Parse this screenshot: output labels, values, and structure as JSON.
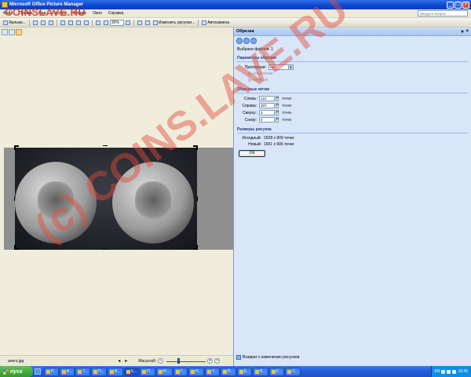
{
  "window": {
    "title": "Microsoft Office Picture Manager"
  },
  "watermark": {
    "top": "COINSLAVE.RU",
    "diagonal": "(c) COINS.LAVE.RU"
  },
  "menubar": {
    "items": [
      "Файл",
      "Правка",
      "Вид",
      "Рисунок",
      "Сервис",
      "Окно",
      "Справка"
    ],
    "help_placeholder": "Введите вопрос"
  },
  "toolbar": {
    "shortcuts_label": "Ярлыки...",
    "zoom_value": "30%",
    "edit_pictures_label": "Изменить рисунки...",
    "autocorrect_label": "Автозамена"
  },
  "canvas": {
    "filename": "avers.jpg",
    "zoom_label": "Масштаб:",
    "zoom_position": 0.3
  },
  "taskpane": {
    "title": "Обрезка",
    "selected_files": "Выбрано файлов: 1",
    "crop_params_title": "Параметры обрезки",
    "proportions_label": "Пропорции:",
    "proportions_value": "Нет",
    "orientation_landscape": "альбомная",
    "orientation_portrait": "книжная",
    "crop_marks_title": "Обрезные метки",
    "left_label": "Слева:",
    "left_value": "121",
    "right_label": "Справа:",
    "right_value": "307",
    "top_label": "Сверху:",
    "top_value": "3",
    "bottom_label": "Снизу:",
    "bottom_value": "0",
    "units": "точек",
    "sizes_title": "Размеры рисунка",
    "original_label": "Исходный:",
    "original_value": "2028 x 909 точек",
    "new_label": "Новый:",
    "new_value": "1601 x 906 точек",
    "ok_label": "ОК",
    "footer_link": "Возврат к изменению рисунков"
  },
  "taskbar": {
    "start_label": "пуск",
    "tasks": [
      "P...",
      "A...",
      "T...",
      "П...",
      "R...",
      "S...",
      "П...",
      "Ki...",
      "T...",
      "H...",
      "Y...",
      "П...",
      "E...",
      "B...",
      "C...",
      "C..."
    ],
    "language": "EN",
    "clock": "16:46"
  }
}
